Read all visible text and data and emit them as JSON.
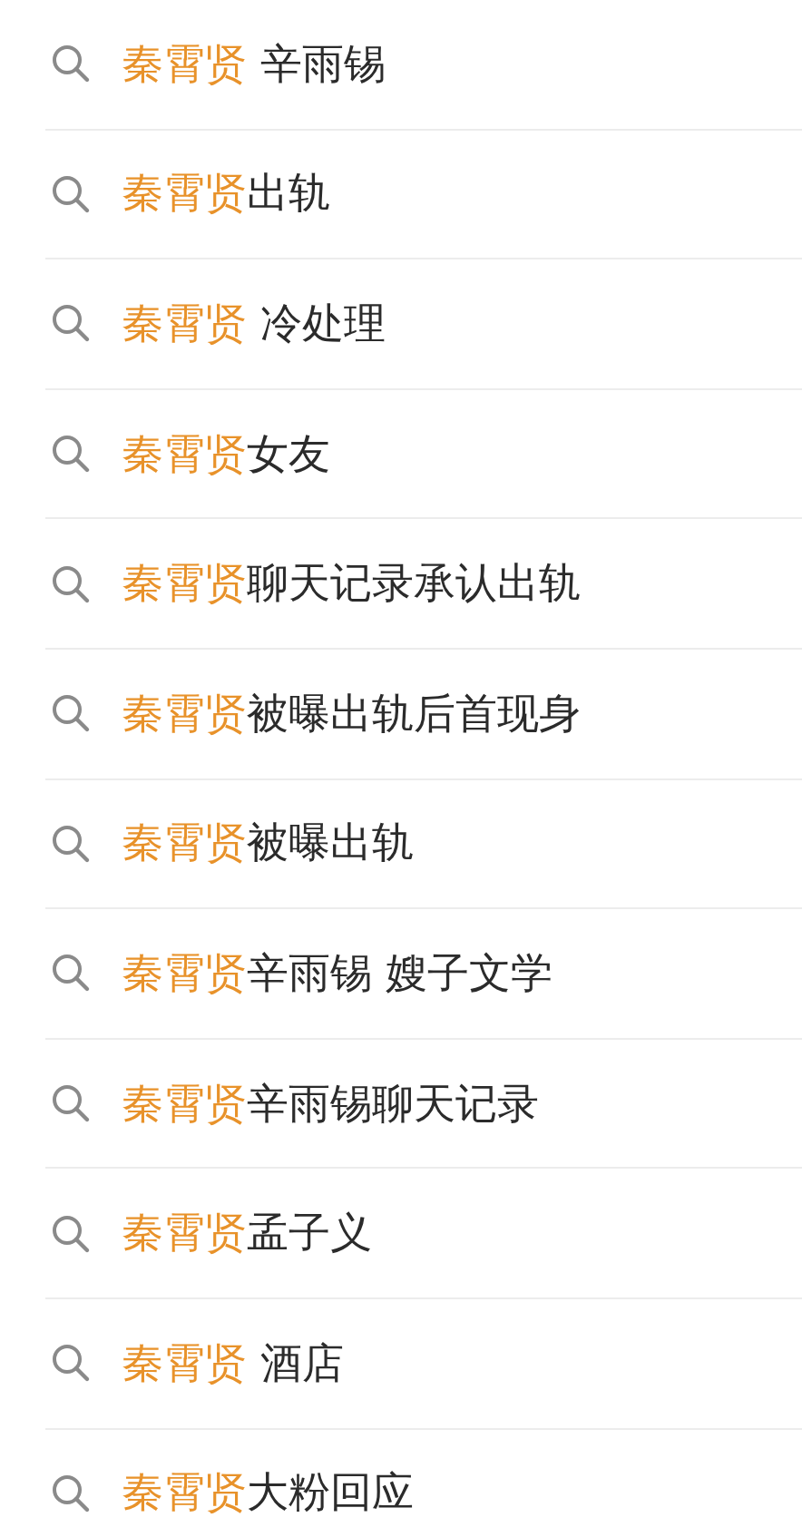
{
  "suggestions": [
    {
      "match": "秦霄贤",
      "rest": " 辛雨锡"
    },
    {
      "match": "秦霄贤",
      "rest": "出轨"
    },
    {
      "match": "秦霄贤",
      "rest": " 冷处理"
    },
    {
      "match": "秦霄贤",
      "rest": "女友"
    },
    {
      "match": "秦霄贤",
      "rest": "聊天记录承认出轨"
    },
    {
      "match": "秦霄贤",
      "rest": "被曝出轨后首现身"
    },
    {
      "match": "秦霄贤",
      "rest": "被曝出轨"
    },
    {
      "match": "秦霄贤",
      "rest": "辛雨锡 嫂子文学"
    },
    {
      "match": "秦霄贤",
      "rest": "辛雨锡聊天记录"
    },
    {
      "match": "秦霄贤",
      "rest": "孟子义"
    },
    {
      "match": "秦霄贤",
      "rest": " 酒店"
    },
    {
      "match": "秦霄贤",
      "rest": "大粉回应"
    }
  ]
}
